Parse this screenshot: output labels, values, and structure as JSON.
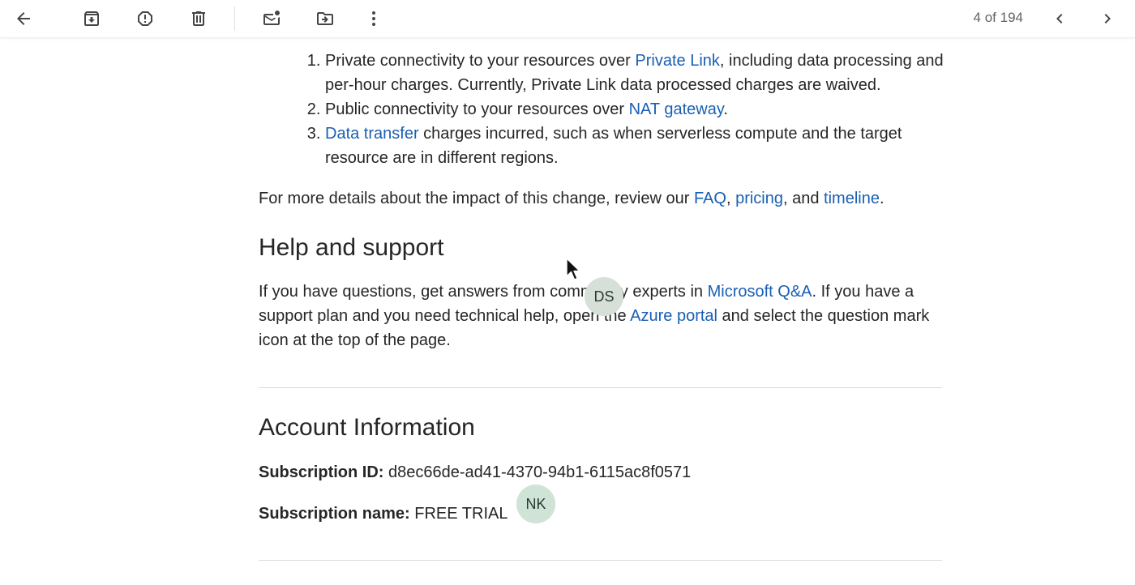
{
  "toolbar": {
    "icons": [
      "back-arrow-icon",
      "archive-icon",
      "report-spam-icon",
      "trash-icon",
      "mark-unread-icon",
      "move-to-icon",
      "more-vert-icon"
    ],
    "pager_text": "4 of 194"
  },
  "email": {
    "charges": [
      {
        "pre": "Private connectivity to your resources over ",
        "link": "Private Link",
        "post": ", including data processing and per-hour charges. Currently, Private Link data processed charges are waived."
      },
      {
        "pre": "Public connectivity to your resources over ",
        "link": "NAT gateway",
        "post": "."
      },
      {
        "pre": "",
        "link": "Data transfer",
        "post": " charges incurred, such as when serverless compute and the target resource are in different regions."
      }
    ],
    "more_details": {
      "pre": "For more details about the impact of this change, review our ",
      "faq": "FAQ",
      "sep1": ", ",
      "pricing": "pricing",
      "sep2": ", and ",
      "timeline": "timeline",
      "post": "."
    },
    "help_heading": "Help and support",
    "help": {
      "pre": "If you have questions, get answers from community experts in ",
      "qa_link": "Microsoft Q&A",
      "mid": ". If you have a support plan and you need technical help, open the ",
      "portal_link": "Azure portal",
      "post": " and select the question mark icon at the top of the page."
    },
    "account_heading": "Account Information",
    "subscription_id_label": "Subscription ID:",
    "subscription_id": "d8ec66de-ad41-4370-94b1-6115ac8f0571",
    "subscription_name_label": "Subscription name:",
    "subscription_name": "FREE TRIAL"
  },
  "avatars": [
    {
      "initials": "DS",
      "color": "#d7dfd9"
    },
    {
      "initials": "NK",
      "color": "#cfe3d6"
    }
  ],
  "colors": {
    "link": "#1a5fb4",
    "text": "#262626",
    "divider": "#dadada"
  }
}
